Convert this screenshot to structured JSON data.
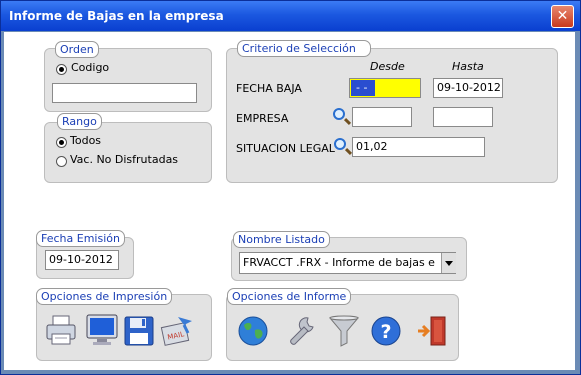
{
  "window": {
    "title": "Informe de Bajas en la empresa"
  },
  "orden": {
    "legend": "Orden",
    "option": "Codigo",
    "field_value": ""
  },
  "rango": {
    "legend": "Rango",
    "options": [
      "Todos",
      "Vac. No Disfrutadas"
    ],
    "selected": "Todos"
  },
  "criterio": {
    "legend": "Criterio de Selección",
    "col_desde": "Desde",
    "col_hasta": "Hasta",
    "rows": [
      {
        "label": "FECHA BAJA",
        "desde": "- -",
        "hasta": "09-10-2012"
      },
      {
        "label": "EMPRESA",
        "desde": "",
        "hasta": ""
      },
      {
        "label": "SITUACION LEGAL",
        "value": "01,02"
      }
    ],
    "highlight_color": "#ffff00"
  },
  "fecha_emision": {
    "legend": "Fecha Emisión",
    "value": "09-10-2012"
  },
  "nombre_listado": {
    "legend": "Nombre Listado",
    "value": "FRVACCT .FRX - Informe de bajas e"
  },
  "opciones_impresion": {
    "legend": "Opciones de Impresión",
    "icons": [
      "printer-icon",
      "monitor-icon",
      "floppy-disk-icon",
      "mail-icon"
    ]
  },
  "opciones_informe": {
    "legend": "Opciones de Informe",
    "icons": [
      "globe-icon",
      "wrench-icon",
      "filter-icon",
      "help-icon",
      "exit-door-icon"
    ]
  }
}
